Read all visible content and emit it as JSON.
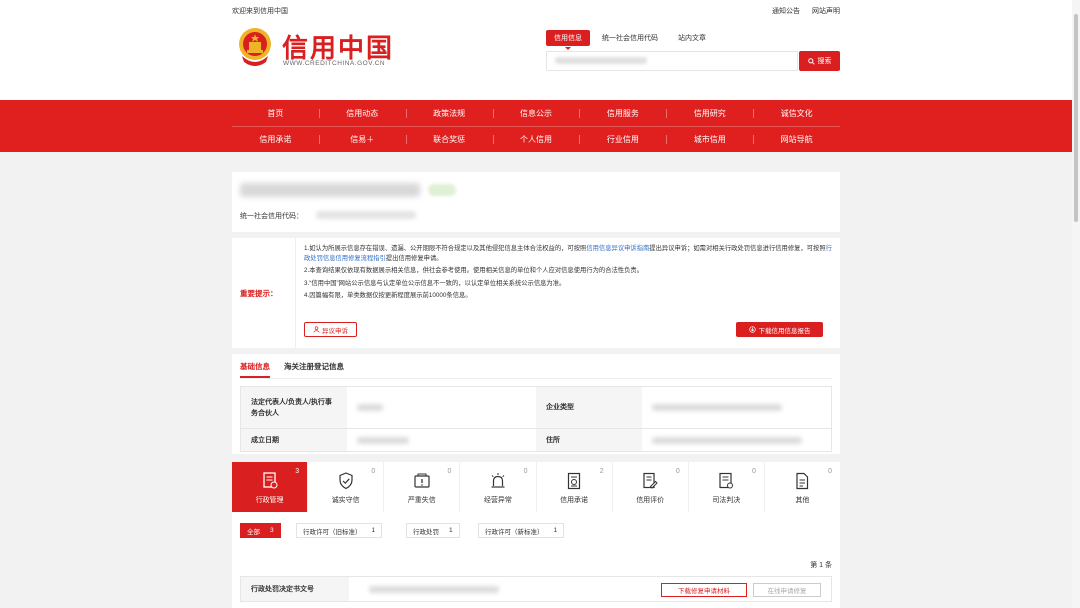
{
  "topbar": {
    "welcome": "欢迎来到信用中国",
    "links": [
      "通知公告",
      "网站声明"
    ]
  },
  "logo": {
    "title": "信用中国",
    "url": "WWW.CREDITCHINA.GOV.CN"
  },
  "search": {
    "tabs": [
      "信用信息",
      "统一社会信用代码",
      "站内文章"
    ],
    "active_tab": "信用信息",
    "button_label": "搜索",
    "icon": "search-icon"
  },
  "nav": {
    "row1": [
      "首页",
      "信用动态",
      "政策法规",
      "信息公示",
      "信用服务",
      "信用研究",
      "诚信文化"
    ],
    "row2": [
      "信用承诺",
      "信易＋",
      "联合奖惩",
      "个人信用",
      "行业信用",
      "城市信用",
      "网站导航"
    ]
  },
  "company": {
    "credit_code_label": "统一社会信用代码："
  },
  "notice": {
    "label": "重要提示：",
    "item1_a": "1.如认为所展示信息存在错误、遗漏、公开期限不符合规定以及其他侵犯信息主体合法权益的，可按照",
    "item1_link1": "信用信息异议申诉指南",
    "item1_b": "提出异议申诉；如需对相关行政处罚信息进行信用修复，可按照",
    "item1_link2": "行政处罚信息信用修复流程指引",
    "item1_c": "提出信用修复申请。",
    "item2": "2.本查询结果仅依现有数据展示相关信息，供社会参考使用。使用相关信息的单位和个人应对信息使用行为的合法性负责。",
    "item3": "3.“信用中国”网站公示信息与认定单位公示信息不一致的，以认定单位相关系统公示信息为准。",
    "item4": "4.因篇幅有限，单类数据仅按更新程度展示前10000条信息。",
    "appeal_button": "异议申诉",
    "download_button": "下载信用信息报告"
  },
  "basic": {
    "tabs": [
      "基础信息",
      "海关注册登记信息"
    ],
    "active_tab": "基础信息",
    "row1": {
      "k1": "法定代表人/负责人/执行事务合伙人",
      "k2": "企业类型"
    },
    "row2": {
      "k1": "成立日期",
      "k2": "住所"
    }
  },
  "categories": [
    {
      "label": "行政管理",
      "count": "3",
      "icon": "document-stamp-icon",
      "active": true
    },
    {
      "label": "诚实守信",
      "count": "0",
      "icon": "shield-check-icon"
    },
    {
      "label": "严重失信",
      "count": "0",
      "icon": "warning-folder-icon"
    },
    {
      "label": "经营异常",
      "count": "0",
      "icon": "alarm-light-icon"
    },
    {
      "label": "信用承诺",
      "count": "2",
      "icon": "pledge-document-icon"
    },
    {
      "label": "信用评价",
      "count": "0",
      "icon": "rating-document-icon"
    },
    {
      "label": "司法判决",
      "count": "0",
      "icon": "judgment-document-icon"
    },
    {
      "label": "其他",
      "count": "0",
      "icon": "more-document-icon"
    }
  ],
  "subtabs": [
    {
      "label": "全部",
      "count": "3",
      "active": true
    },
    {
      "label": "行政许可（旧标准）",
      "count": "1"
    },
    {
      "label": "行政处罚",
      "count": "1"
    },
    {
      "label": "行政许可（新标准）",
      "count": "1"
    }
  ],
  "records": {
    "total": "第 1 条",
    "row_label": "行政处罚决定书文号",
    "btn_download": "下载修复申请材料",
    "btn_online": "在线申请修复"
  },
  "colors": {
    "accent": "#d91f1f",
    "nav": "#e0201f",
    "link": "#2f6fc9"
  }
}
